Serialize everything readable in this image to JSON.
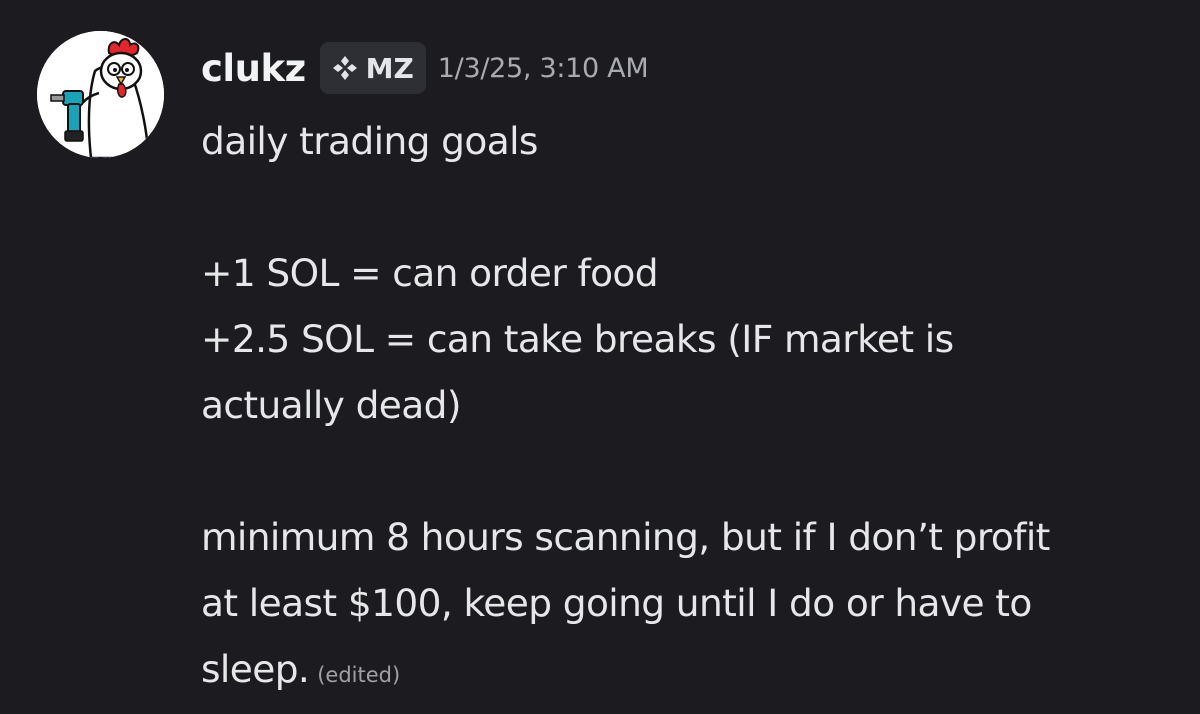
{
  "message": {
    "author": {
      "username": "clukz",
      "tag": {
        "icon": "diamond-cluster-icon",
        "text": "MZ"
      },
      "avatar": {
        "icon": "rooster-with-drill-avatar",
        "colors": {
          "background": "#ffffff",
          "comb": "#e2262b",
          "drill": "#1aa3b8"
        }
      }
    },
    "timestamp": "1/3/25, 3:10 AM",
    "lines": {
      "l1": "daily trading goals",
      "l2": "+1 SOL = can order food",
      "l3": "+2.5 SOL = can take breaks (IF market is",
      "l4": "actually dead)",
      "l5": "minimum 8 hours scanning, but if I don’t profit",
      "l6": "at least $100, keep going until I do or have to",
      "l7": "sleep."
    },
    "edited_label": "(edited)"
  },
  "colors": {
    "background": "#1c1c20",
    "username": "#f2f3f5",
    "text": "#e6e7e9",
    "timestamp": "#a9abb1",
    "tag_background": "#2e2f35"
  }
}
